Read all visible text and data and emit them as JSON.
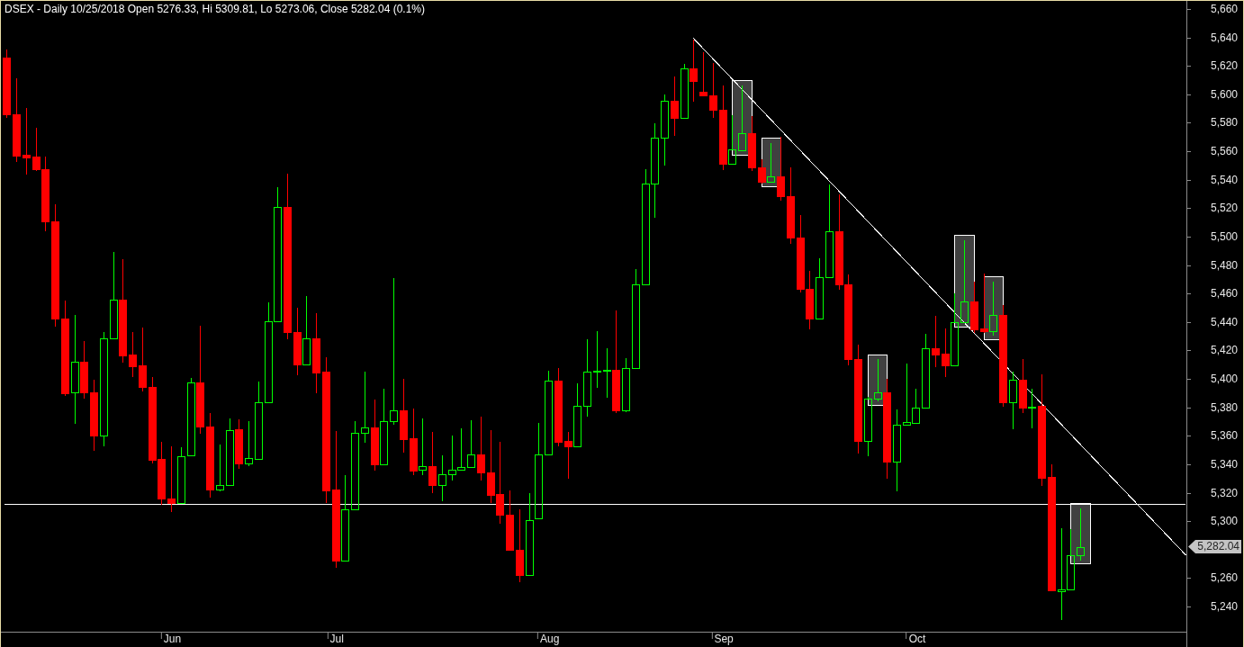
{
  "chart": {
    "chart_data": {
      "type": "candlestick",
      "title": "DSEX - Daily 10/25/2018 Open 5276.33, Hi 5309.81, Lo 5273.06, Close 5282.04 (0.1%)",
      "ylim": [
        5222.3,
        5665.7
      ],
      "yticks": [
        {
          "value": 5660,
          "label": "5,660"
        },
        {
          "value": 5640,
          "label": "5,640"
        },
        {
          "value": 5620,
          "label": "5,620"
        },
        {
          "value": 5600,
          "label": "5,600"
        },
        {
          "value": 5580,
          "label": "5,580"
        },
        {
          "value": 5560,
          "label": "5,560"
        },
        {
          "value": 5540,
          "label": "5,540"
        },
        {
          "value": 5520,
          "label": "5,520"
        },
        {
          "value": 5500,
          "label": "5,500"
        },
        {
          "value": 5480,
          "label": "5,480"
        },
        {
          "value": 5460,
          "label": "5,460"
        },
        {
          "value": 5440,
          "label": "5,440"
        },
        {
          "value": 5420,
          "label": "5,420"
        },
        {
          "value": 5400,
          "label": "5,400"
        },
        {
          "value": 5380,
          "label": "5,380"
        },
        {
          "value": 5360,
          "label": "5,360"
        },
        {
          "value": 5340,
          "label": "5,340"
        },
        {
          "value": 5320,
          "label": "5,320"
        },
        {
          "value": 5300,
          "label": "5,300"
        },
        {
          "value": 5260,
          "label": "5,260"
        },
        {
          "value": 5240,
          "label": "5,240"
        }
      ],
      "categories": [
        null,
        null,
        null,
        null,
        null,
        null,
        null,
        null,
        null,
        null,
        null,
        null,
        null,
        null,
        null,
        null,
        null,
        "Jun",
        null,
        null,
        null,
        null,
        null,
        null,
        null,
        null,
        null,
        null,
        null,
        null,
        null,
        null,
        null,
        null,
        "Jul",
        null,
        null,
        null,
        null,
        null,
        null,
        null,
        null,
        null,
        null,
        null,
        null,
        null,
        null,
        null,
        null,
        null,
        null,
        null,
        null,
        null,
        "Aug",
        null,
        null,
        null,
        null,
        null,
        null,
        null,
        null,
        null,
        null,
        null,
        null,
        null,
        null,
        null,
        null,
        null,
        "Sep",
        null,
        null,
        null,
        null,
        null,
        null,
        null,
        null,
        null,
        null,
        null,
        null,
        null,
        null,
        null,
        null,
        null,
        null,
        null,
        "Oct",
        null,
        null,
        null,
        null,
        null,
        null,
        null,
        null,
        null,
        null,
        null,
        null,
        null,
        null,
        null,
        null,
        null,
        null,
        null,
        null,
        null,
        null,
        null,
        null,
        null,
        null,
        null
      ],
      "ohlc": [
        [
          5625.7,
          5632.1,
          5584.3,
          5585.8
        ],
        [
          5585.8,
          5611.9,
          5553.3,
          5557.1
        ],
        [
          5557.4,
          5591.0,
          5544.1,
          5555.9
        ],
        [
          5556.5,
          5577.4,
          5547.0,
          5547.3
        ],
        [
          5547.6,
          5556.8,
          5504.1,
          5510.5
        ],
        [
          5510.8,
          5523.5,
          5437.5,
          5442.4
        ],
        [
          5442.7,
          5456.0,
          5388.8,
          5389.7
        ],
        [
          5390.3,
          5445.6,
          5369.1,
          5412.0
        ],
        [
          5412.0,
          5427.3,
          5386.8,
          5390.8
        ],
        [
          5390.8,
          5399.8,
          5350.0,
          5360.5
        ],
        [
          5360.5,
          5433.7,
          5353.5,
          5428.5
        ],
        [
          5428.8,
          5489.6,
          5428.8,
          5455.7
        ],
        [
          5455.7,
          5485.0,
          5412.0,
          5416.6
        ],
        [
          5416.9,
          5433.7,
          5401.9,
          5409.1
        ],
        [
          5409.4,
          5436.9,
          5391.7,
          5394.3
        ],
        [
          5394.6,
          5402.1,
          5341.0,
          5343.4
        ],
        [
          5343.6,
          5356.1,
          5312.4,
          5315.8
        ],
        [
          5316.1,
          5353.5,
          5307.1,
          5312.9
        ],
        [
          5312.9,
          5352.3,
          5312.9,
          5345.7
        ],
        [
          5346.3,
          5401.6,
          5346.3,
          5397.5
        ],
        [
          5397.5,
          5438.1,
          5362.2,
          5366.2
        ],
        [
          5366.2,
          5376.7,
          5317.3,
          5322.2
        ],
        [
          5322.2,
          5354.4,
          5321.6,
          5325.7
        ],
        [
          5325.4,
          5372.6,
          5325.4,
          5364.2
        ],
        [
          5364.5,
          5372.3,
          5337.3,
          5340.7
        ],
        [
          5340.7,
          5370.9,
          5339.6,
          5344.2
        ],
        [
          5343.9,
          5398.7,
          5343.9,
          5383.9
        ],
        [
          5383.9,
          5454.6,
          5383.9,
          5440.7
        ],
        [
          5440.7,
          5535.4,
          5440.7,
          5520.9
        ],
        [
          5520.9,
          5544.7,
          5428.8,
          5433.1
        ],
        [
          5433.1,
          5450.8,
          5403.3,
          5410.3
        ],
        [
          5410.3,
          5458.9,
          5410.3,
          5428.2
        ],
        [
          5428.2,
          5447.0,
          5390.6,
          5404.5
        ],
        [
          5404.8,
          5415.8,
          5313.5,
          5321.6
        ],
        [
          5322.2,
          5364.2,
          5268.0,
          5272.4
        ],
        [
          5272.4,
          5333.2,
          5272.4,
          5308.6
        ],
        [
          5308.6,
          5370.9,
          5308.6,
          5361.9
        ],
        [
          5361.9,
          5405.6,
          5355.8,
          5365.7
        ],
        [
          5365.7,
          5386.0,
          5336.1,
          5340.2
        ],
        [
          5340.2,
          5393.5,
          5340.2,
          5370.6
        ],
        [
          5370.6,
          5471.7,
          5368.6,
          5378.1
        ],
        [
          5378.1,
          5400.4,
          5348.6,
          5357.8
        ],
        [
          5358.1,
          5380.1,
          5333.2,
          5335.8
        ],
        [
          5336.1,
          5372.6,
          5333.2,
          5339.0
        ],
        [
          5339.0,
          5363.6,
          5320.2,
          5325.1
        ],
        [
          5325.1,
          5347.1,
          5314.7,
          5333.2
        ],
        [
          5333.2,
          5360.7,
          5328.9,
          5336.1
        ],
        [
          5336.1,
          5365.7,
          5336.1,
          5338.1
        ],
        [
          5338.1,
          5371.5,
          5338.1,
          5347.1
        ],
        [
          5347.1,
          5373.8,
          5329.2,
          5334.4
        ],
        [
          5334.4,
          5364.5,
          5313.5,
          5318.7
        ],
        [
          5319.0,
          5356.1,
          5299.0,
          5304.8
        ],
        [
          5304.8,
          5322.2,
          5279.6,
          5279.6
        ],
        [
          5279.6,
          5308.9,
          5257.9,
          5262.3
        ],
        [
          5262.3,
          5320.2,
          5262.3,
          5300.8
        ],
        [
          5302.2,
          5369.4,
          5302.2,
          5347.1
        ],
        [
          5347.1,
          5406.5,
          5347.1,
          5399.0
        ],
        [
          5399.0,
          5408.5,
          5353.5,
          5355.8
        ],
        [
          5356.1,
          5363.6,
          5330.3,
          5352.9
        ],
        [
          5352.9,
          5397.8,
          5352.9,
          5381.0
        ],
        [
          5381.0,
          5428.8,
          5374.3,
          5405.3
        ],
        [
          5405.0,
          5434.0,
          5394.6,
          5405.9
        ],
        [
          5405.6,
          5422.4,
          5387.7,
          5406.5
        ],
        [
          5406.5,
          5448.5,
          5376.7,
          5378.1
        ],
        [
          5378.1,
          5415.5,
          5377.2,
          5407.7
        ],
        [
          5407.7,
          5478.0,
          5407.7,
          5466.5
        ],
        [
          5466.5,
          5548.1,
          5466.5,
          5537.4
        ],
        [
          5537.1,
          5580.6,
          5513.7,
          5569.6
        ],
        [
          5569.6,
          5600.6,
          5550.4,
          5595.3
        ],
        [
          5595.6,
          5613.3,
          5571.6,
          5583.2
        ],
        [
          5583.2,
          5622.3,
          5583.2,
          5618.2
        ],
        [
          5618.2,
          5639.4,
          5595.6,
          5609.2
        ],
        [
          5601.7,
          5630.1,
          5599.1,
          5599.1
        ],
        [
          5599.1,
          5622.9,
          5583.8,
          5589.0
        ],
        [
          5589.3,
          5606.9,
          5547.6,
          5551.0
        ],
        [
          5551.0,
          5585.8,
          5551.0,
          5561.5
        ],
        [
          5560.6,
          5606.9,
          5560.6,
          5572.7
        ],
        [
          5572.7,
          5585.2,
          5547.0,
          5548.4
        ],
        [
          5548.7,
          5554.8,
          5538.0,
          5538.6
        ],
        [
          5538.6,
          5566.4,
          5538.6,
          5542.3
        ],
        [
          5542.3,
          5570.7,
          5525.8,
          5528.4
        ],
        [
          5528.4,
          5549.6,
          5495.4,
          5499.2
        ],
        [
          5499.5,
          5516.0,
          5461.5,
          5463.3
        ],
        [
          5463.6,
          5476.6,
          5435.5,
          5442.4
        ],
        [
          5442.4,
          5485.6,
          5442.4,
          5471.7
        ],
        [
          5471.7,
          5537.4,
          5471.7,
          5503.8
        ],
        [
          5503.8,
          5530.2,
          5463.6,
          5466.2
        ],
        [
          5466.2,
          5474.0,
          5410.0,
          5413.7
        ],
        [
          5414.0,
          5424.4,
          5348.3,
          5356.4
        ],
        [
          5356.4,
          5388.3,
          5346.3,
          5386.2
        ],
        [
          5386.2,
          5414.3,
          5384.8,
          5390.3
        ],
        [
          5390.3,
          5400.4,
          5330.3,
          5341.9
        ],
        [
          5341.9,
          5379.0,
          5321.6,
          5368.0
        ],
        [
          5367.7,
          5411.4,
          5367.7,
          5369.4
        ],
        [
          5369.1,
          5394.0,
          5369.1,
          5380.1
        ],
        [
          5380.1,
          5432.3,
          5380.1,
          5421.5
        ],
        [
          5421.5,
          5444.7,
          5409.1,
          5417.2
        ],
        [
          5417.8,
          5436.0,
          5402.1,
          5409.7
        ],
        [
          5409.7,
          5460.7,
          5409.7,
          5440.1
        ],
        [
          5439.8,
          5498.3,
          5439.8,
          5454.6
        ],
        [
          5454.6,
          5469.3,
          5433.1,
          5434.6
        ],
        [
          5435.5,
          5474.6,
          5433.1,
          5433.7
        ],
        [
          5433.7,
          5469.3,
          5431.1,
          5445.0
        ],
        [
          5445.0,
          5452.8,
          5381.0,
          5383.9
        ],
        [
          5383.9,
          5405.6,
          5365.1,
          5399.3
        ],
        [
          5399.3,
          5414.9,
          5376.7,
          5379.6
        ],
        [
          5380.1,
          5393.5,
          5365.7,
          5380.7
        ],
        [
          5381.0,
          5403.6,
          5325.7,
          5330.3
        ],
        [
          5330.9,
          5340.5,
          5251.5,
          5251.5
        ],
        [
          5250.9,
          5295.6,
          5231.3,
          5252.1
        ],
        [
          5252.1,
          5295.0,
          5252.1,
          5275.9
        ],
        [
          5276.33,
          5309.81,
          5273.06,
          5282.04
        ],
        null,
        null,
        null,
        null,
        null,
        null,
        null,
        null,
        null,
        null
      ],
      "ref_lines": [
        {
          "axis": "y",
          "value": 5312.4
        }
      ]
    },
    "last_price_label": "5,282.04"
  }
}
